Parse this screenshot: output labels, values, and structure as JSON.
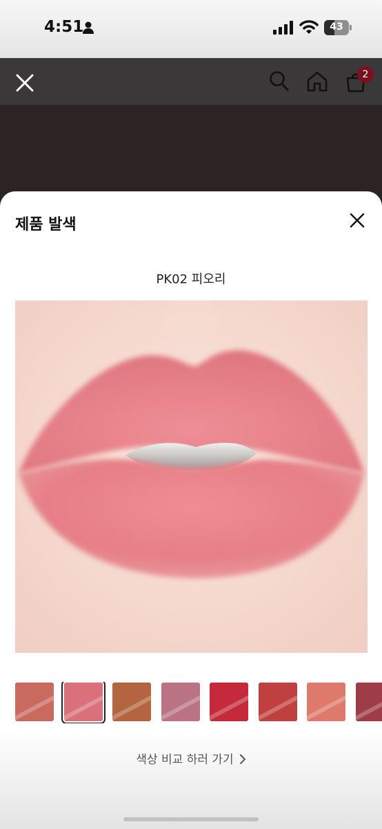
{
  "status_bar": {
    "time": "4:51",
    "battery_text": "43",
    "battery_level_percent": 43
  },
  "nav": {
    "cart_count": "2",
    "icons": [
      "close-icon",
      "search-icon",
      "home-icon",
      "shopping-bag-icon"
    ]
  },
  "sheet": {
    "title": "제품 발색",
    "shade_name": "PK02 피오리",
    "compare_link": "색상 비교 하러 가기",
    "selected_swatch_index": 1,
    "swatches": [
      {
        "color": "#c96a5e"
      },
      {
        "color": "#d9707a"
      },
      {
        "color": "#b3653f"
      },
      {
        "color": "#b97382"
      },
      {
        "color": "#c42a3c"
      },
      {
        "color": "#c0403f"
      },
      {
        "color": "#dd7a6c"
      },
      {
        "color": "#9e3d47"
      }
    ]
  },
  "colors": {
    "lip_base": "#e88089",
    "skin": "#f4d3c9",
    "nav_background": "#3a3838",
    "badge": "#7a1020"
  }
}
